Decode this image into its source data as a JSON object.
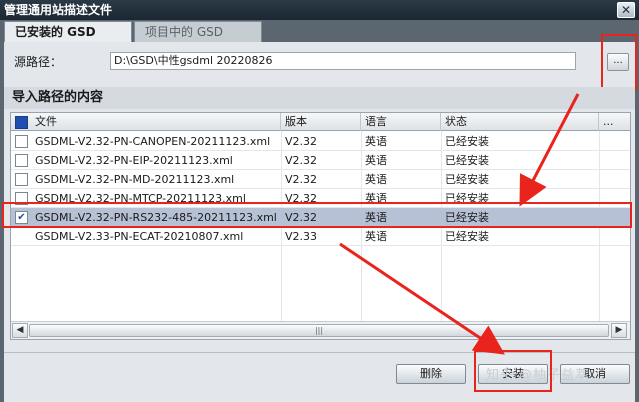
{
  "window": {
    "title": "管理通用站描述文件",
    "close_label": "✕"
  },
  "tabs": [
    {
      "label": "已安装的 GSD",
      "active": true
    },
    {
      "label": "项目中的 GSD",
      "active": false
    }
  ],
  "source_path": {
    "label": "源路径：",
    "value": "D:\\GSD\\中性gsdml 20220826",
    "browse_label": "..."
  },
  "section_title": "导入路径的内容",
  "table": {
    "columns": [
      "文件",
      "版本",
      "语言",
      "状态",
      "..."
    ],
    "rows": [
      {
        "file": "GSDML-V2.32-PN-CANOPEN-20211123.xml",
        "version": "V2.32",
        "language": "英语",
        "status": "已经安装",
        "checked": false
      },
      {
        "file": "GSDML-V2.32-PN-EIP-20211123.xml",
        "version": "V2.32",
        "language": "英语",
        "status": "已经安装",
        "checked": false
      },
      {
        "file": "GSDML-V2.32-PN-MD-20211123.xml",
        "version": "V2.32",
        "language": "英语",
        "status": "已经安装",
        "checked": false
      },
      {
        "file": "GSDML-V2.32-PN-MTCP-20211123.xml",
        "version": "V2.32",
        "language": "英语",
        "status": "已经安装",
        "checked": false
      },
      {
        "file": "GSDML-V2.32-PN-RS232-485-20211123.xml",
        "version": "V2.32",
        "language": "英语",
        "status": "已经安装",
        "checked": true
      },
      {
        "file": "GSDML-V2.33-PN-ECAT-20210807.xml",
        "version": "V2.33",
        "language": "英语",
        "status": "已经安装",
        "checked": false
      }
    ],
    "scroll_thumb_label": "|||"
  },
  "buttons": {
    "delete": "删除",
    "install": "安装",
    "cancel": "取消"
  },
  "watermark": "知乎 @柚子益萃",
  "colors": {
    "highlight": "#e8241c",
    "selected_row": "#b7c1d6",
    "check": "#1f4fb0"
  }
}
